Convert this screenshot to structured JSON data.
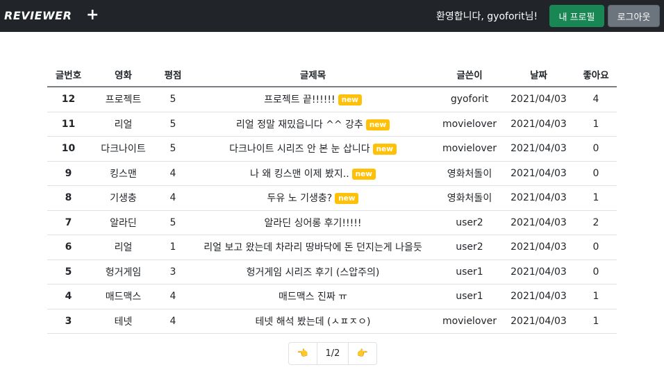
{
  "navbar": {
    "brand": "REVIEWER",
    "add_icon": "+",
    "welcome": "환영합니다, gyoforit님!",
    "profile_label": "내 프로필",
    "logout_label": "로그아웃"
  },
  "table": {
    "headers": [
      "글번호",
      "영화",
      "평점",
      "글제목",
      "글쓴이",
      "날짜",
      "좋아요"
    ],
    "new_badge": "new",
    "rows": [
      {
        "no": "12",
        "movie": "프로젝트",
        "rating": "5",
        "title": "프로젝트 끝!!!!!!",
        "is_new": true,
        "author": "gyoforit",
        "date": "2021/04/03",
        "likes": "4"
      },
      {
        "no": "11",
        "movie": "리얼",
        "rating": "5",
        "title": "리얼 정말 재밌읍니다 ^^ 강추",
        "is_new": true,
        "author": "movielover",
        "date": "2021/04/03",
        "likes": "1"
      },
      {
        "no": "10",
        "movie": "다크나이트",
        "rating": "5",
        "title": "다크나이트 시리즈 안 본 눈 삽니다",
        "is_new": true,
        "author": "movielover",
        "date": "2021/04/03",
        "likes": "0"
      },
      {
        "no": "9",
        "movie": "킹스맨",
        "rating": "4",
        "title": "나 왜 킹스맨 이제 봤지..",
        "is_new": true,
        "author": "영화처돌이",
        "date": "2021/04/03",
        "likes": "0"
      },
      {
        "no": "8",
        "movie": "기생충",
        "rating": "4",
        "title": "두유 노 기생충?",
        "is_new": true,
        "author": "영화처돌이",
        "date": "2021/04/03",
        "likes": "1"
      },
      {
        "no": "7",
        "movie": "알라딘",
        "rating": "5",
        "title": "알라딘 싱어롱 후기!!!!!",
        "is_new": false,
        "author": "user2",
        "date": "2021/04/03",
        "likes": "2"
      },
      {
        "no": "6",
        "movie": "리얼",
        "rating": "1",
        "title": "리얼 보고 왔는데 차라리 땅바닥에 돈 던지는게 나을듯",
        "is_new": false,
        "author": "user2",
        "date": "2021/04/03",
        "likes": "0"
      },
      {
        "no": "5",
        "movie": "헝거게임",
        "rating": "3",
        "title": "헝거게임 시리즈 후기 (스압주의)",
        "is_new": false,
        "author": "user1",
        "date": "2021/04/03",
        "likes": "0"
      },
      {
        "no": "4",
        "movie": "매드맥스",
        "rating": "4",
        "title": "매드맥스 진짜 ㅠ",
        "is_new": false,
        "author": "user1",
        "date": "2021/04/03",
        "likes": "1"
      },
      {
        "no": "3",
        "movie": "테넷",
        "rating": "4",
        "title": "테넷 해석 봤는데 (ㅅㅍㅈㅇ)",
        "is_new": false,
        "author": "movielover",
        "date": "2021/04/03",
        "likes": "1"
      }
    ]
  },
  "pagination": {
    "prev_icon": "👈",
    "page_label": "1/2",
    "next_icon": "👉"
  }
}
